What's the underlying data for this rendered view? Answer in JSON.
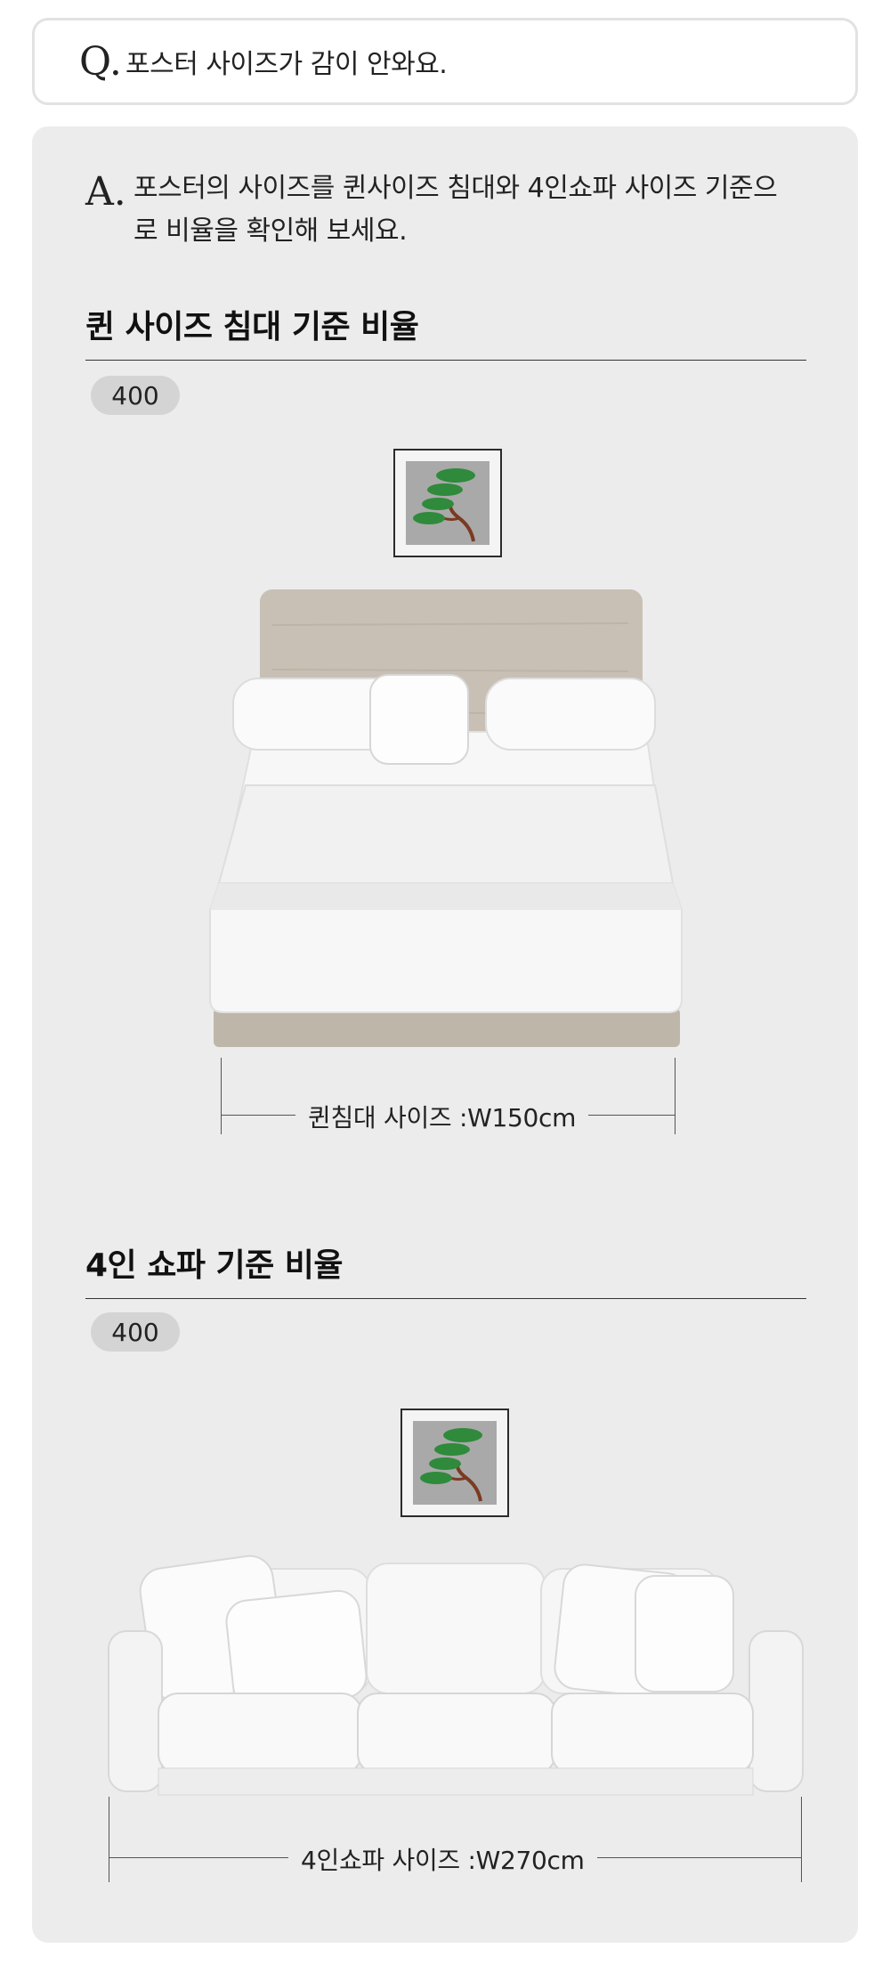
{
  "question": {
    "mark": "Q.",
    "text": "포스터 사이즈가 감이 안와요."
  },
  "answer": {
    "mark": "A.",
    "text": "포스터의 사이즈를 퀸사이즈 침대와 4인쇼파 사이즈 기준으로 비율을 확인해 보세요."
  },
  "sections": [
    {
      "title": "퀸 사이즈 침대 기준 비율",
      "badge": "400",
      "furniture_icon": "queen-bed",
      "dimension_label": "퀸침대 사이즈 :W150cm"
    },
    {
      "title": "4인 쇼파 기준 비율",
      "badge": "400",
      "furniture_icon": "four-seat-sofa",
      "dimension_label": "4인쇼파 사이즈 :W270cm"
    }
  ],
  "colors": {
    "panel_bg": "#ececec",
    "badge_bg": "#d4d4d4",
    "bed_wood": "#c8c0b4",
    "poster_tree_green": "#2f8a3c",
    "poster_tree_trunk": "#7a3a22"
  }
}
